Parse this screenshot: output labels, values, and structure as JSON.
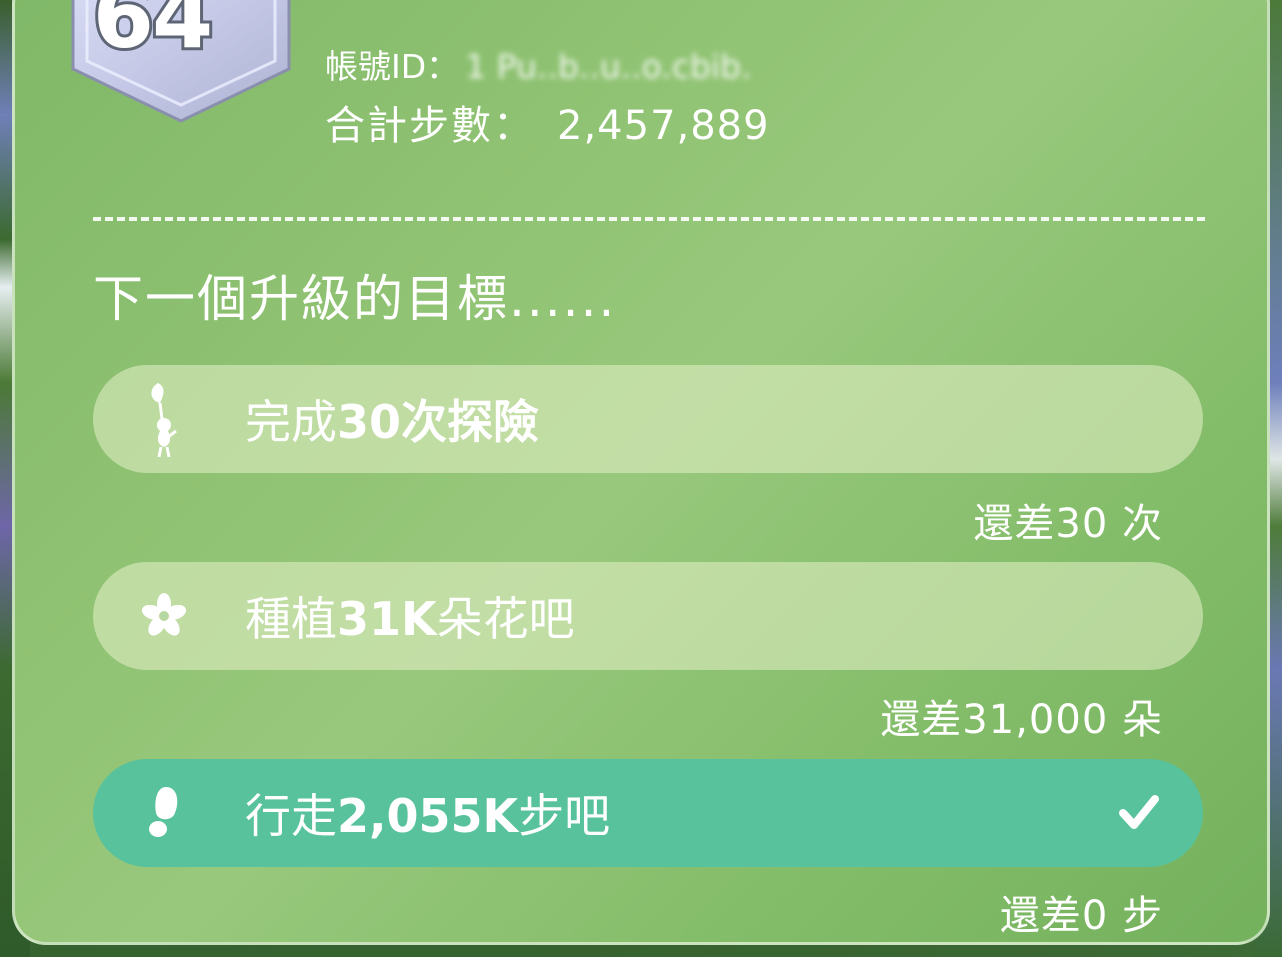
{
  "profile": {
    "level": "64",
    "account_label": "帳號ID：",
    "account_value": "1 Pu..b..u..o.cbib.",
    "steps_label": "合計步數：",
    "steps_value": "2,457,889"
  },
  "goals_section": {
    "title": "下一個升級的目標......",
    "goals": [
      {
        "prefix": "完成",
        "bold": "30次探險",
        "suffix": "",
        "remaining": "還差30 次",
        "icon": "pikmin-sprout-icon",
        "completed": false
      },
      {
        "prefix": "種植",
        "bold": "31K",
        "suffix": "朵花吧",
        "remaining": "還差31,000 朵",
        "icon": "flower-icon",
        "completed": false
      },
      {
        "prefix": "行走",
        "bold": "2,055K",
        "suffix": "步吧",
        "remaining": "還差0 步",
        "icon": "footprint-icon",
        "completed": true
      }
    ]
  },
  "colors": {
    "panel": "#8fc272",
    "goal_pill": "#e6f0c8",
    "goal_done": "#58c29c",
    "text": "#ffffff"
  }
}
